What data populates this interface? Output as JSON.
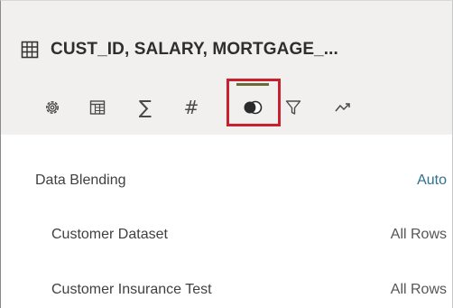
{
  "header": {
    "title": "CUST_ID, SALARY, MORTGAGE_...",
    "title_icon": "table-grid-icon"
  },
  "toolbar": {
    "tabs": [
      {
        "icon": "gear-icon",
        "active": false
      },
      {
        "icon": "columns-icon",
        "active": false
      },
      {
        "icon": "sum-icon",
        "glyph": "∑",
        "active": false
      },
      {
        "icon": "hash-icon",
        "glyph": "#",
        "active": false
      },
      {
        "icon": "data-blending-icon",
        "active": true,
        "highlighted": true
      },
      {
        "icon": "filter-icon",
        "active": false
      },
      {
        "icon": "trend-icon",
        "active": false
      }
    ],
    "active_bar_color": "#6b6b3a",
    "highlight_color": "#c9202e"
  },
  "properties": {
    "data_blending": {
      "label": "Data Blending",
      "value": "Auto"
    },
    "datasets": [
      {
        "label": "Customer Dataset",
        "value": "All Rows"
      },
      {
        "label": "Customer Insurance Test",
        "value": "All Rows"
      }
    ]
  },
  "colors": {
    "header_bg": "#f1f0ef",
    "link_value": "#2f6f8f"
  }
}
